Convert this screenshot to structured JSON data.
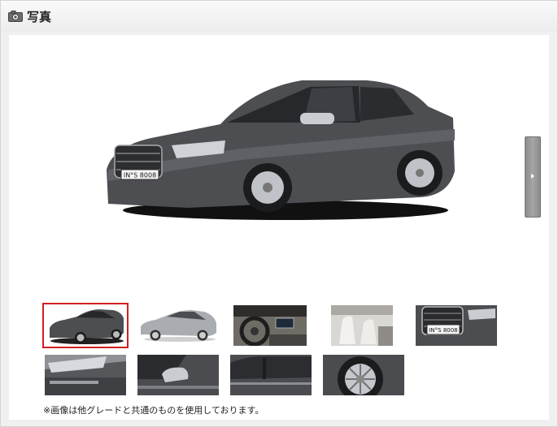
{
  "header": {
    "title": "写真",
    "icon": "camera-icon"
  },
  "main_photo": {
    "plate_text": "IN°S 8008"
  },
  "thumbnails": [
    {
      "subject": "front-three-quarter",
      "selected": true
    },
    {
      "subject": "side-silver"
    },
    {
      "subject": "steering-wheel"
    },
    {
      "subject": "seats"
    },
    {
      "subject": "grille-front",
      "plate_text": "IN°S 8008"
    },
    {
      "subject": "headlight"
    },
    {
      "subject": "side-mirror"
    },
    {
      "subject": "side-window"
    },
    {
      "subject": "wheel"
    }
  ],
  "note": "※画像は他グレードと共通のものを使用しております。",
  "colors": {
    "selected_border": "#d21f1f",
    "car_body": "#4a4c50",
    "panel_bg": "#f0f0f0"
  }
}
